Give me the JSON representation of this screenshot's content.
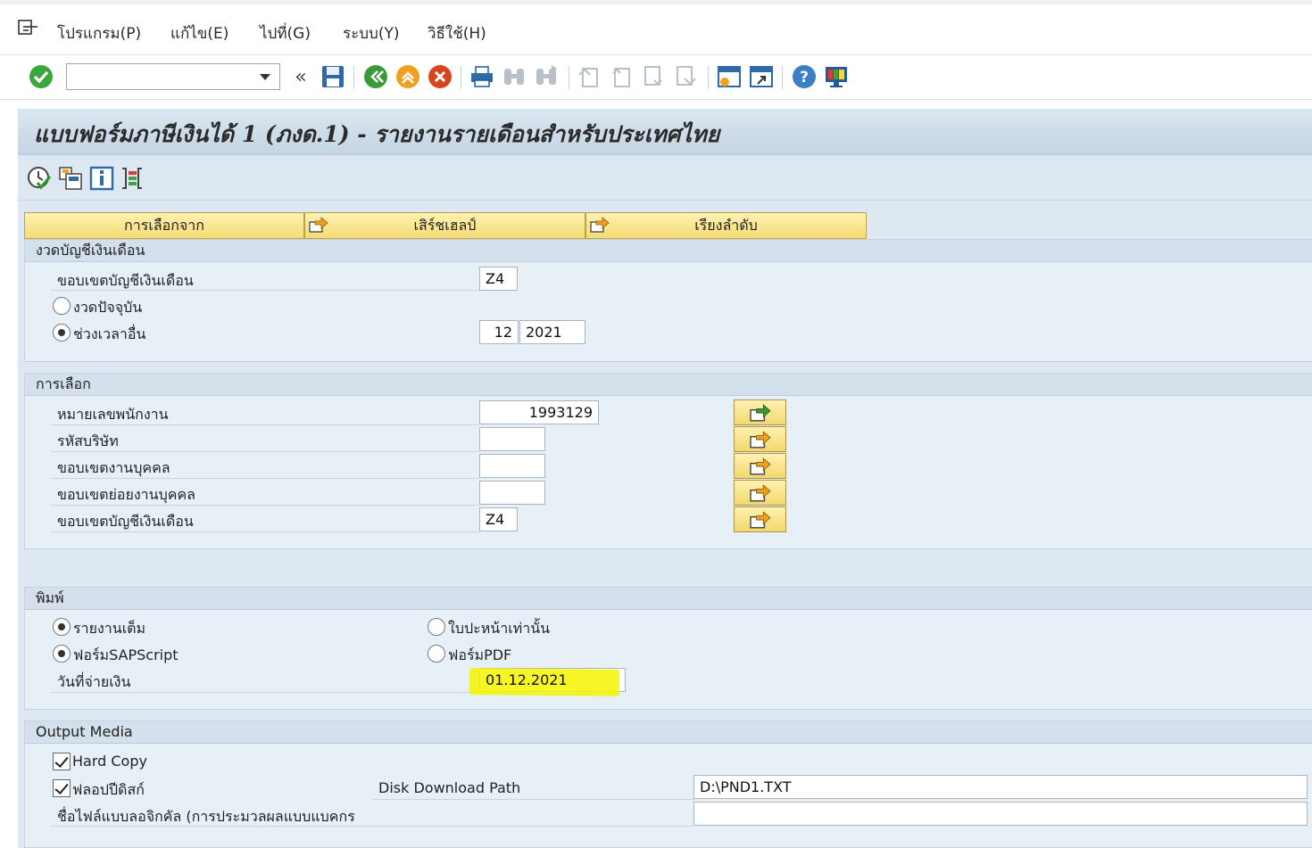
{
  "menu": {
    "items": [
      "โปรแกรม(P)",
      "แก้ไข(E)",
      "ไปที่(G)",
      "ระบบ(Y)",
      "วิธีใช้(H)"
    ]
  },
  "toolbar": {
    "command_value": "",
    "icons": [
      "enter-icon",
      "save-icon",
      "back-icon",
      "exit-icon",
      "cancel-icon",
      "print-icon",
      "find-icon",
      "find-next-icon",
      "first-page-icon",
      "previous-page-icon",
      "next-page-icon",
      "last-page-icon",
      "create-session-icon",
      "shortcut-icon",
      "help-icon",
      "layout-icon"
    ]
  },
  "title": "แบบฟอร์มภาษีเงินได้ 1 (ภงด.1) - รายงานรายเดือนสำหรับประเทศไทย",
  "app_toolbar": {
    "icons": [
      "execute-icon",
      "variants-icon",
      "info-icon",
      "selection-options-icon"
    ]
  },
  "tabs": [
    "การเลือกจาก",
    "เสิร์ชเฮลป์",
    "เรียงลำดับ"
  ],
  "period": {
    "header": "งวดบัญชีเงินเดือน",
    "area_label": "ขอบเขตบัญชีเงินเดือน",
    "area_value": "Z4",
    "current_label": "งวดปัจจุบัน",
    "other_label": "ช่วงเวลาอื่น",
    "month": "12",
    "year": "2021"
  },
  "selection": {
    "header": "การเลือก",
    "rows": [
      {
        "label": "หมายเลขพนักงาน",
        "value": "1993129"
      },
      {
        "label": "รหัสบริษัท",
        "value": ""
      },
      {
        "label": "ขอบเขตงานบุคคล",
        "value": ""
      },
      {
        "label": "ขอบเขตย่อยงานบุคคล",
        "value": ""
      },
      {
        "label": "ขอบเขตบัญชีเงินเดือน",
        "value": "Z4"
      }
    ]
  },
  "print": {
    "header": "พิมพ์",
    "full_report": "รายงานเต็ม",
    "cover_only": "ใบปะหน้าเท่านั้น",
    "sapscript": "ฟอร์มSAPScript",
    "pdf": "ฟอร์มPDF",
    "pay_date_label": "วันที่จ่ายเงิน",
    "pay_date_value": "01.12.2021",
    "highlight_color": "#f5f500"
  },
  "output": {
    "header": "Output Media",
    "hard_copy": "Hard Copy",
    "floppy": "ฟลอปปีดิสก์",
    "path_label": "Disk Download Path",
    "path_value": "D:\\PND1.TXT",
    "logical_file_label": "ชื่อไฟล์แบบลอจิกคัล (การประมวลผลแบบแบคกร",
    "logical_file_value": ""
  }
}
